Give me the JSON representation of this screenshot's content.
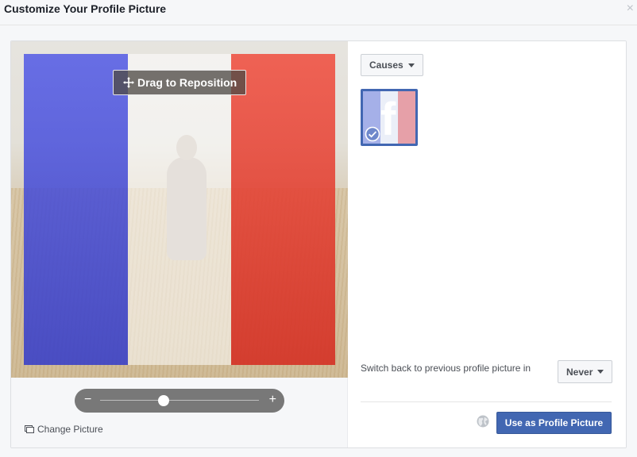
{
  "dialog": {
    "title": "Customize Your Profile Picture",
    "close_glyph": "×"
  },
  "editor": {
    "drag_label": "Drag to Reposition",
    "zoom": {
      "minus": "−",
      "plus": "+",
      "level": 0.4
    },
    "change_picture_label": "Change Picture",
    "overlay_flag_colors": [
      "#3b46d8",
      "#ffffff",
      "#e8402f"
    ]
  },
  "sidebar": {
    "category_dropdown": "Causes",
    "selected_frame": {
      "icon": "facebook-f-icon",
      "selected": true
    },
    "switch_back_label": "Switch back to previous profile picture in",
    "switch_back_value": "Never",
    "privacy_icon": "globe-icon",
    "submit_label": "Use as Profile Picture"
  },
  "colors": {
    "accent": "#4267b2",
    "header_bg": "#f6f7f9"
  }
}
